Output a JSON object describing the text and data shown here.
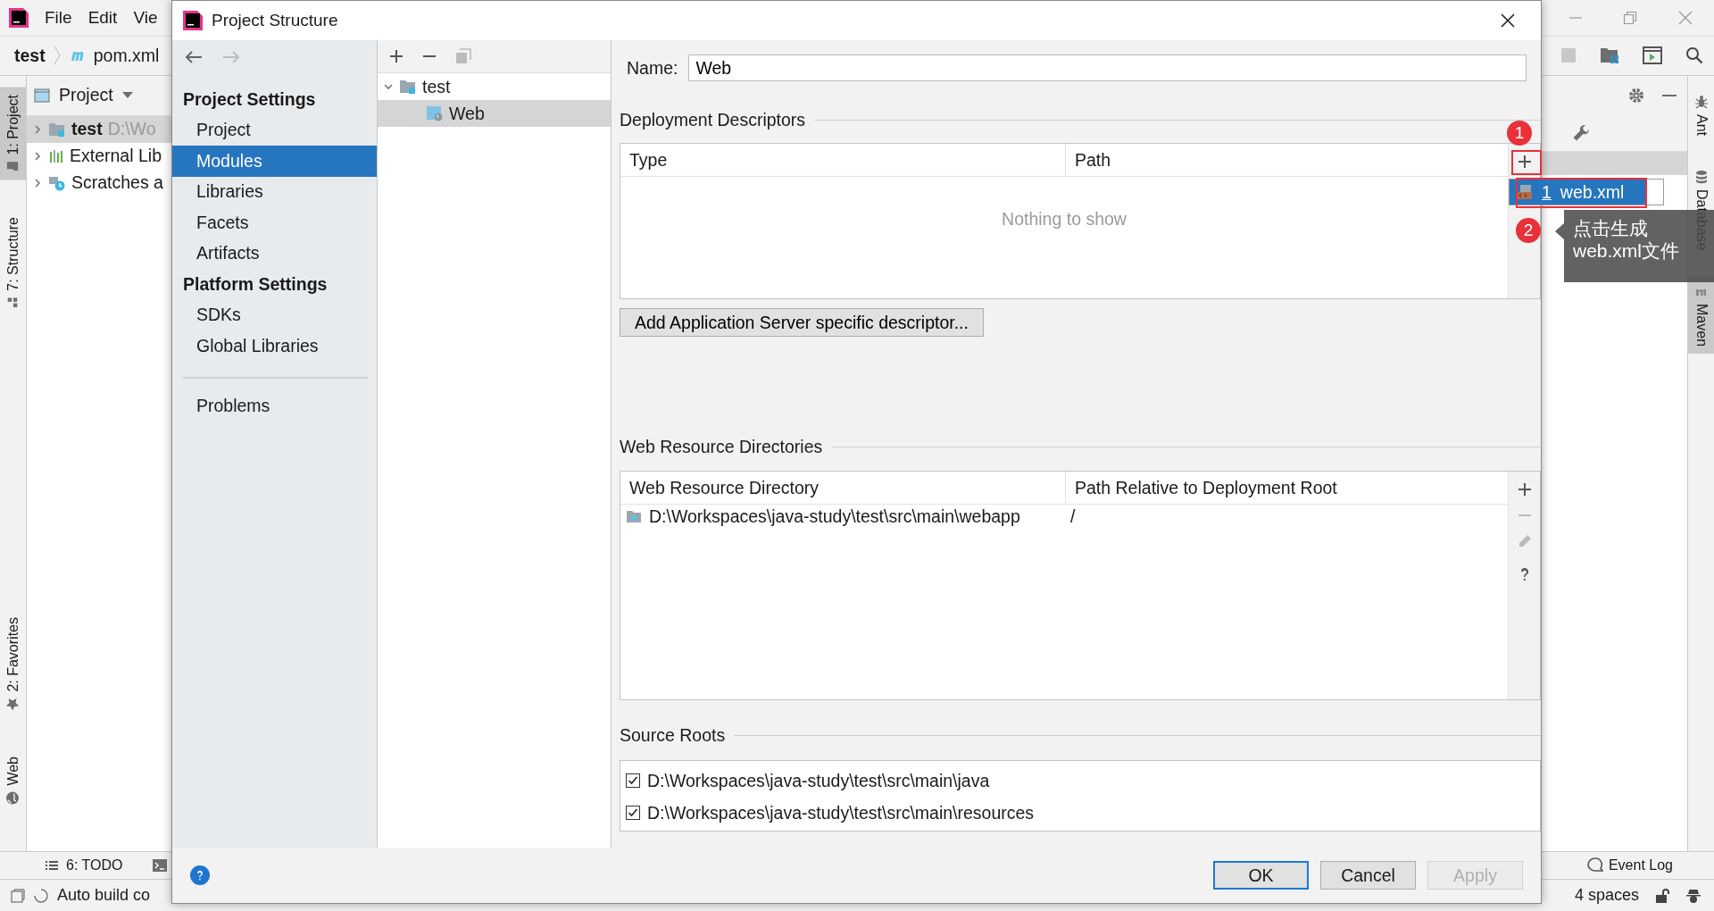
{
  "ide": {
    "menu": [
      "File",
      "Edit",
      "Vie"
    ],
    "breadcrumbs": [
      {
        "label": "test",
        "kind": "module"
      },
      {
        "label": "pom.xml",
        "kind": "maven"
      }
    ],
    "left_tools": [
      {
        "label": "1: Project",
        "kind": "folder",
        "selected": true
      },
      {
        "label": "7: Structure",
        "kind": "structure",
        "selected": false
      }
    ],
    "left_tools_bottom": [
      {
        "label": "2: Favorites",
        "kind": "star",
        "selected": false
      },
      {
        "label": "Web",
        "kind": "globe",
        "selected": false
      }
    ],
    "project_panel": {
      "title": "Project",
      "tree": [
        {
          "label": "test",
          "hint": "D:\\Wo",
          "kind": "module",
          "expanded": false,
          "selected": true
        },
        {
          "label": "External Lib",
          "kind": "library",
          "expanded": false,
          "selected": false
        },
        {
          "label": "Scratches a",
          "kind": "scratches",
          "expanded": false,
          "selected": false
        }
      ]
    },
    "right_tools": [
      {
        "label": "Ant",
        "kind": "ant",
        "selected": false
      },
      {
        "label": "Database",
        "kind": "database",
        "selected": false
      },
      {
        "label": "Maven",
        "kind": "maven",
        "selected": true
      }
    ],
    "bottom_tools": [
      {
        "label": "6: TODO",
        "kind": "todo"
      }
    ],
    "event_log": "Event Log",
    "status": "Auto build co",
    "indent": "4 spaces"
  },
  "dialog": {
    "title": "Project Structure",
    "nav": {
      "sections": [
        {
          "heading": "Project Settings",
          "items": [
            {
              "label": "Project",
              "selected": false
            },
            {
              "label": "Modules",
              "selected": true
            },
            {
              "label": "Libraries",
              "selected": false
            },
            {
              "label": "Facets",
              "selected": false
            },
            {
              "label": "Artifacts",
              "selected": false
            }
          ]
        },
        {
          "heading": "Platform Settings",
          "items": [
            {
              "label": "SDKs",
              "selected": false
            },
            {
              "label": "Global Libraries",
              "selected": false
            }
          ]
        }
      ],
      "problems": "Problems"
    },
    "module_tree": [
      {
        "label": "test",
        "kind": "folder",
        "expanded": true,
        "selected": false,
        "children": [
          {
            "label": "Web",
            "kind": "web",
            "selected": true
          }
        ]
      }
    ],
    "name": {
      "label": "Name:",
      "value": "Web"
    },
    "deployment": {
      "title": "Deployment Descriptors",
      "columns": [
        "Type",
        "Path"
      ],
      "empty": "Nothing to show",
      "tools": [
        {
          "kind": "add",
          "disabled": false
        }
      ],
      "button": "Add Application Server specific descriptor..."
    },
    "web_resources": {
      "title": "Web Resource Directories",
      "columns": [
        "Web Resource Directory",
        "Path Relative to Deployment Root"
      ],
      "rows": [
        {
          "directory": "D:\\Workspaces\\java-study\\test\\src\\main\\webapp",
          "path": "/"
        }
      ],
      "tools": [
        {
          "kind": "add",
          "disabled": false
        },
        {
          "kind": "remove",
          "disabled": true
        },
        {
          "kind": "edit",
          "disabled": true
        },
        {
          "kind": "help",
          "disabled": false
        }
      ]
    },
    "source_roots": {
      "title": "Source Roots",
      "items": [
        {
          "path": "D:\\Workspaces\\java-study\\test\\src\\main\\java",
          "checked": true
        },
        {
          "path": "D:\\Workspaces\\java-study\\test\\src\\main\\resources",
          "checked": true
        }
      ]
    },
    "buttons": [
      {
        "label": "OK",
        "default": true,
        "disabled": false
      },
      {
        "label": "Cancel",
        "default": false,
        "disabled": false
      },
      {
        "label": "Apply",
        "default": false,
        "disabled": true
      }
    ]
  },
  "popup": {
    "items": [
      {
        "number": "1",
        "label": "web.xml",
        "selected": true
      }
    ]
  },
  "annotations": [
    {
      "number": "1"
    },
    {
      "number": "2"
    }
  ],
  "tooltip": {
    "lines": [
      "点击生成",
      "web.xml文件"
    ]
  }
}
